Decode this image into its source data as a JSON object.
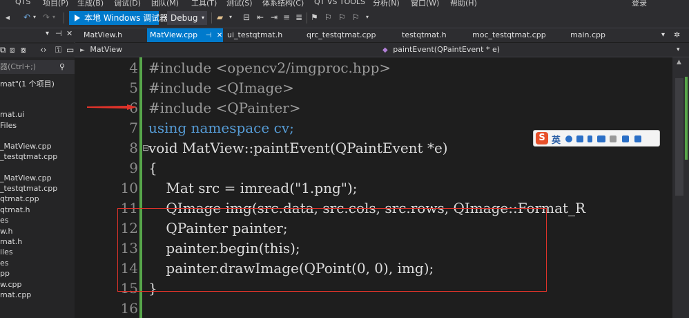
{
  "menu": [
    "QTS",
    "项目(P)",
    "生成(B)",
    "调试(D)",
    "团队(M)",
    "工具(T)",
    "测试(S)",
    "体系结构(C)",
    "QT VS TOOLS",
    "分析(N)",
    "窗口(W)",
    "帮助(H)"
  ],
  "account": "登录",
  "toolbar": {
    "debugger_label": "本地 Windows 调试器",
    "config_label": "Debug"
  },
  "sidebar": {
    "search_placeholder": "器(Ctrl+;)",
    "items": [
      "mat\"(1 个项目)",
      "mat.ui",
      "Files",
      "_MatView.cpp",
      "_testqtmat.cpp",
      "_MatView.cpp",
      "_testqtmat.cpp",
      "qtmat.cpp",
      "qtmat.h",
      "es",
      "w.h",
      "mat.h",
      "iles",
      "es",
      "pp",
      "w.cpp",
      "mat.cpp"
    ]
  },
  "tabs": [
    {
      "label": "MatView.h"
    },
    {
      "label": "MatView.cpp"
    },
    {
      "label": "ui_testqtmat.h"
    },
    {
      "label": "qrc_testqtmat.cpp"
    },
    {
      "label": "testqtmat.h"
    },
    {
      "label": "moc_testqtmat.cpp"
    },
    {
      "label": "main.cpp"
    }
  ],
  "navbar": {
    "scope": "MatView",
    "member": "paintEvent(QPaintEvent * e)"
  },
  "editor": {
    "line_numbers": [
      "4",
      "5",
      "6",
      "7",
      "8",
      "9",
      "10",
      "11",
      "12",
      "13",
      "14",
      "15",
      "16"
    ],
    "lines": [
      "#include <opencv2/imgproc.hpp>",
      "#include <QImage>",
      "#include <QPainter>",
      "using namespace cv;",
      "void MatView::paintEvent(QPaintEvent *e)",
      "{",
      "    Mat src = imread(\"1.png\");",
      "    QImage img(src.data, src.cols, src.rows, QImage::Format_R",
      "    QPainter painter;",
      "    painter.begin(this);",
      "    painter.drawImage(QPoint(0, 0), img);",
      "}",
      ""
    ]
  },
  "ime": {
    "logo": "S",
    "mode": "英"
  },
  "colors": {
    "accent": "#007acc",
    "annotation": "#e0332a",
    "gutter": "#57a64a"
  }
}
